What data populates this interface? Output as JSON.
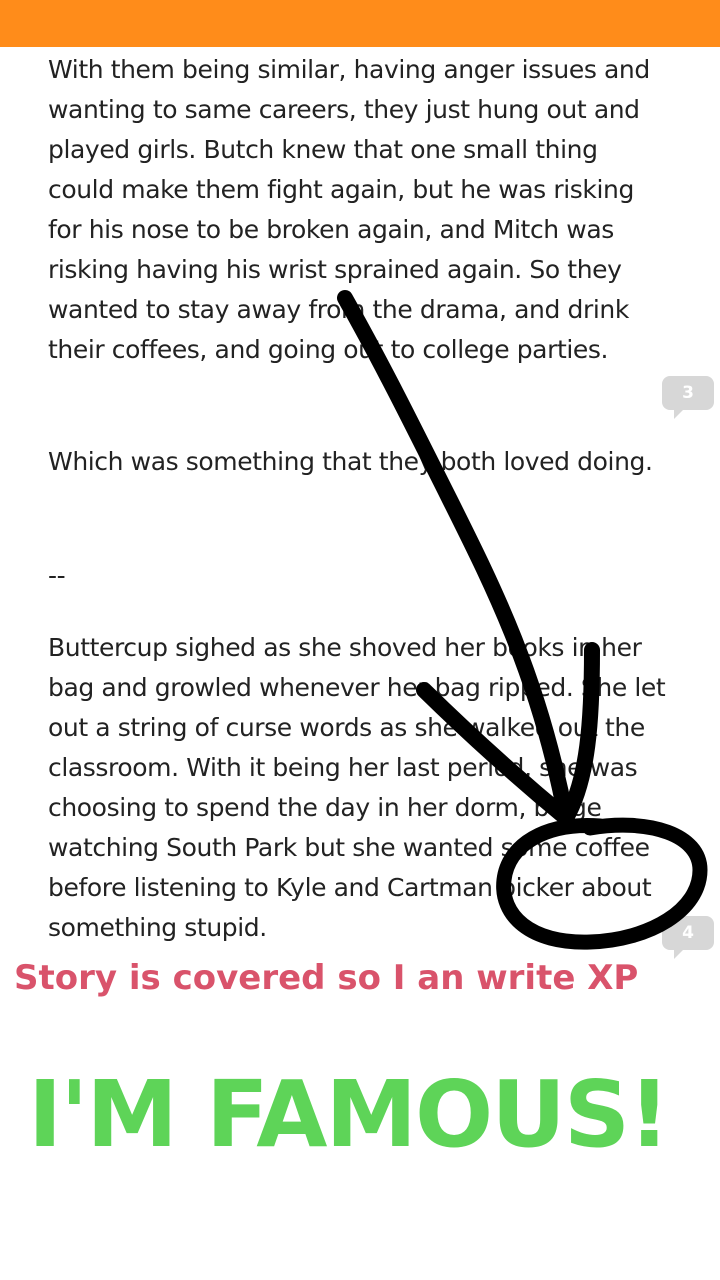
{
  "story": {
    "paragraphs": [
      "With them being similar, having anger issues and wanting to same careers, they just hung out and played girls. Butch knew that one small thing could make them fight again, but he was risking for his nose to be broken again, and Mitch was risking having his wrist sprained again. So they wanted to stay away from the drama, and drink their coffees, and going out to college parties.",
      "Which was something that they both loved doing.",
      "--",
      "Buttercup sighed as she shoved her books in her bag and growled whenever her bag ripped. She let out a string of curse words as she walked out the classroom. With it being her last period, she was choosing to spend the day in her dorm, binge watching South Park but she wanted some coffee before listening to Kyle and Cartman bicker about something stupid."
    ]
  },
  "comment_counts": [
    "3",
    "4"
  ],
  "overlay": {
    "caption": "Story is covered so I  an write XP",
    "headline": "I'M FAMOUS!"
  },
  "colors": {
    "top_bar": "#ff8c1a",
    "caption": "#d9536b",
    "headline": "#5ed458",
    "doodle": "#000000"
  }
}
